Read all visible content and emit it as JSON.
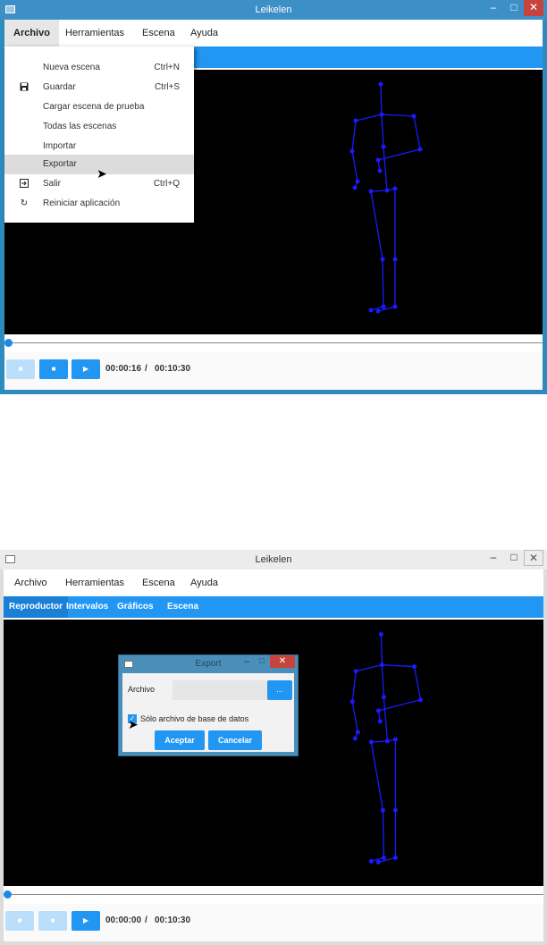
{
  "window": {
    "title": "Leikelen",
    "min_glyph": "–",
    "max_glyph": "□",
    "close_glyph": "✕"
  },
  "menubar": {
    "items": [
      "Archivo",
      "Herramientas",
      "Escena",
      "Ayuda"
    ]
  },
  "tabs": [
    "Reproductor",
    "Intervalos",
    "Gráficos",
    "Escena"
  ],
  "archivo_menu": {
    "items": [
      {
        "label": "Nueva escena",
        "shortcut": "Ctrl+N",
        "icon": ""
      },
      {
        "label": "Guardar",
        "shortcut": "Ctrl+S",
        "icon": "save-icon"
      },
      {
        "label": "Cargar escena de prueba",
        "shortcut": "",
        "icon": ""
      },
      {
        "label": "Todas las escenas",
        "shortcut": "",
        "icon": ""
      },
      {
        "label": "Importar",
        "shortcut": "",
        "icon": ""
      },
      {
        "label": "Exportar",
        "shortcut": "",
        "icon": ""
      },
      {
        "label": "Salir",
        "shortcut": "Ctrl+Q",
        "icon": "exit-icon"
      },
      {
        "label": "Reiniciar aplicación",
        "shortcut": "",
        "icon": "refresh-icon"
      }
    ],
    "hovered": "Exportar"
  },
  "player_top": {
    "current_time": "00:00:16",
    "separator": "/",
    "total_time": "00:10:30",
    "progress": 0
  },
  "player_bottom": {
    "current_time": "00:00:00",
    "separator": "/",
    "total_time": "00:10:30",
    "progress": 0
  },
  "export_dialog": {
    "title": "Export",
    "file_label": "Archivo",
    "file_value": "",
    "browse_label": "...",
    "checkbox_label": "Sólo archivo de base de datos",
    "checkbox_checked": true,
    "accept_label": "Aceptar",
    "cancel_label": "Cancelar"
  },
  "colors": {
    "accent": "#2196f3",
    "skeleton": "#1a1aff",
    "viewport_bg": "#000000"
  }
}
